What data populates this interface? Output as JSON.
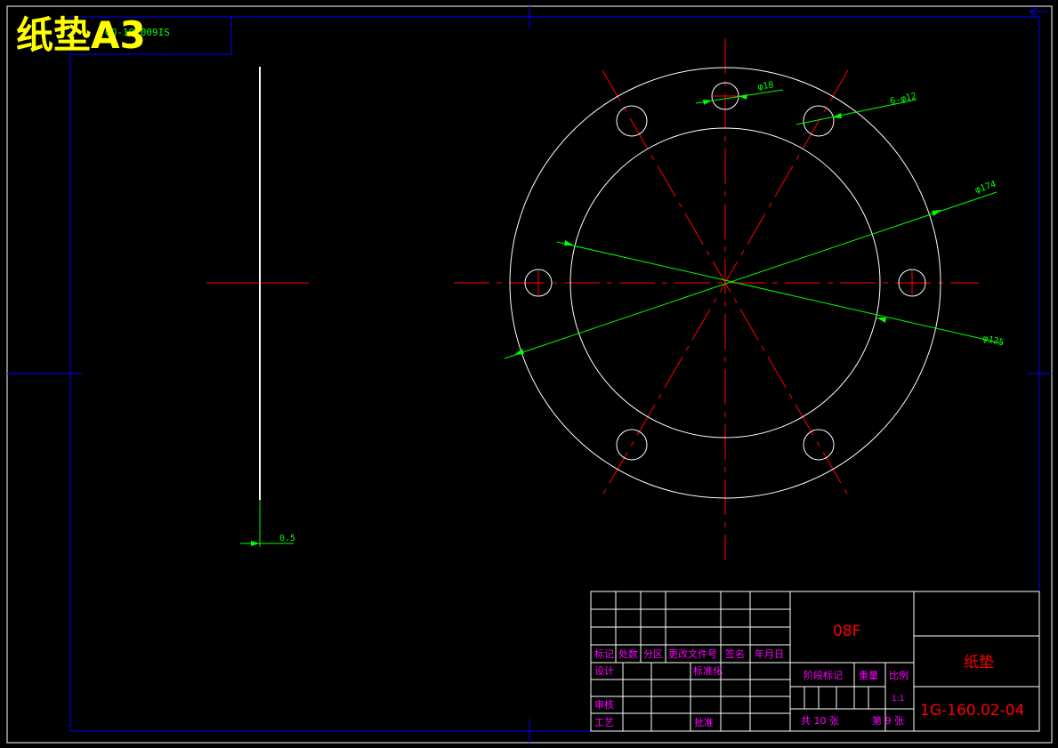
{
  "title": {
    "main": "纸垫A3",
    "code": "GQ-10-009IS"
  },
  "dimensions": {
    "thickness": "0.5",
    "hole_dia": "φ18",
    "bolt_holes": "6-φ12",
    "outer_dia": "φ174",
    "inner_dia": "φ125"
  },
  "title_block": {
    "headers": [
      "标记",
      "处数",
      "分区",
      "更改文件号",
      "签名",
      "年月日"
    ],
    "row_design": "设计",
    "row_standard": "标准化",
    "row_check": "审核",
    "row_process": "工艺",
    "row_approve": "批准",
    "material": "08F",
    "stage_mark": "阶段标记",
    "weight": "重量",
    "scale_label": "比例",
    "scale_value": "1:1",
    "total_sheets": "共 10 张",
    "sheet_no": "第 9 张",
    "part_name": "纸垫",
    "drawing_no": "1G-160.02-04"
  },
  "colors": {
    "background": "#000000",
    "frame": "#0000ff",
    "outline": "#ffffff",
    "centerline": "#ff0000",
    "dimension": "#00ff00",
    "title_text": "#ffff00",
    "label_text": "#ff00ff",
    "block_value": "#ff0000"
  }
}
